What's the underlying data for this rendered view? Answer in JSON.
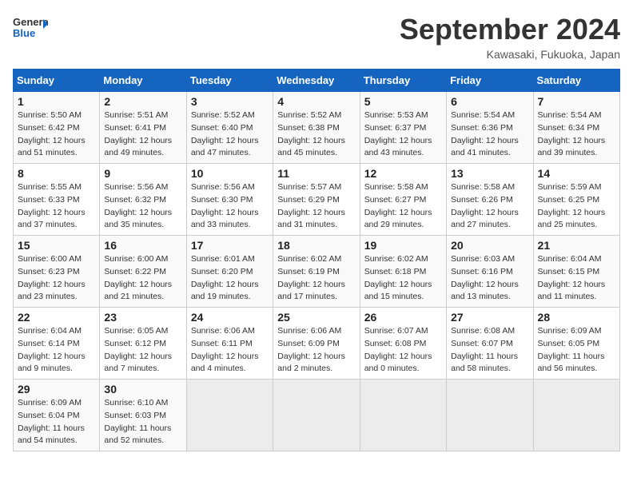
{
  "header": {
    "logo_general": "General",
    "logo_blue": "Blue",
    "month_title": "September 2024",
    "location": "Kawasaki, Fukuoka, Japan"
  },
  "weekdays": [
    "Sunday",
    "Monday",
    "Tuesday",
    "Wednesday",
    "Thursday",
    "Friday",
    "Saturday"
  ],
  "weeks": [
    [
      {
        "day": "1",
        "lines": [
          "Sunrise: 5:50 AM",
          "Sunset: 6:42 PM",
          "Daylight: 12 hours",
          "and 51 minutes."
        ]
      },
      {
        "day": "2",
        "lines": [
          "Sunrise: 5:51 AM",
          "Sunset: 6:41 PM",
          "Daylight: 12 hours",
          "and 49 minutes."
        ]
      },
      {
        "day": "3",
        "lines": [
          "Sunrise: 5:52 AM",
          "Sunset: 6:40 PM",
          "Daylight: 12 hours",
          "and 47 minutes."
        ]
      },
      {
        "day": "4",
        "lines": [
          "Sunrise: 5:52 AM",
          "Sunset: 6:38 PM",
          "Daylight: 12 hours",
          "and 45 minutes."
        ]
      },
      {
        "day": "5",
        "lines": [
          "Sunrise: 5:53 AM",
          "Sunset: 6:37 PM",
          "Daylight: 12 hours",
          "and 43 minutes."
        ]
      },
      {
        "day": "6",
        "lines": [
          "Sunrise: 5:54 AM",
          "Sunset: 6:36 PM",
          "Daylight: 12 hours",
          "and 41 minutes."
        ]
      },
      {
        "day": "7",
        "lines": [
          "Sunrise: 5:54 AM",
          "Sunset: 6:34 PM",
          "Daylight: 12 hours",
          "and 39 minutes."
        ]
      }
    ],
    [
      {
        "day": "8",
        "lines": [
          "Sunrise: 5:55 AM",
          "Sunset: 6:33 PM",
          "Daylight: 12 hours",
          "and 37 minutes."
        ]
      },
      {
        "day": "9",
        "lines": [
          "Sunrise: 5:56 AM",
          "Sunset: 6:32 PM",
          "Daylight: 12 hours",
          "and 35 minutes."
        ]
      },
      {
        "day": "10",
        "lines": [
          "Sunrise: 5:56 AM",
          "Sunset: 6:30 PM",
          "Daylight: 12 hours",
          "and 33 minutes."
        ]
      },
      {
        "day": "11",
        "lines": [
          "Sunrise: 5:57 AM",
          "Sunset: 6:29 PM",
          "Daylight: 12 hours",
          "and 31 minutes."
        ]
      },
      {
        "day": "12",
        "lines": [
          "Sunrise: 5:58 AM",
          "Sunset: 6:27 PM",
          "Daylight: 12 hours",
          "and 29 minutes."
        ]
      },
      {
        "day": "13",
        "lines": [
          "Sunrise: 5:58 AM",
          "Sunset: 6:26 PM",
          "Daylight: 12 hours",
          "and 27 minutes."
        ]
      },
      {
        "day": "14",
        "lines": [
          "Sunrise: 5:59 AM",
          "Sunset: 6:25 PM",
          "Daylight: 12 hours",
          "and 25 minutes."
        ]
      }
    ],
    [
      {
        "day": "15",
        "lines": [
          "Sunrise: 6:00 AM",
          "Sunset: 6:23 PM",
          "Daylight: 12 hours",
          "and 23 minutes."
        ]
      },
      {
        "day": "16",
        "lines": [
          "Sunrise: 6:00 AM",
          "Sunset: 6:22 PM",
          "Daylight: 12 hours",
          "and 21 minutes."
        ]
      },
      {
        "day": "17",
        "lines": [
          "Sunrise: 6:01 AM",
          "Sunset: 6:20 PM",
          "Daylight: 12 hours",
          "and 19 minutes."
        ]
      },
      {
        "day": "18",
        "lines": [
          "Sunrise: 6:02 AM",
          "Sunset: 6:19 PM",
          "Daylight: 12 hours",
          "and 17 minutes."
        ]
      },
      {
        "day": "19",
        "lines": [
          "Sunrise: 6:02 AM",
          "Sunset: 6:18 PM",
          "Daylight: 12 hours",
          "and 15 minutes."
        ]
      },
      {
        "day": "20",
        "lines": [
          "Sunrise: 6:03 AM",
          "Sunset: 6:16 PM",
          "Daylight: 12 hours",
          "and 13 minutes."
        ]
      },
      {
        "day": "21",
        "lines": [
          "Sunrise: 6:04 AM",
          "Sunset: 6:15 PM",
          "Daylight: 12 hours",
          "and 11 minutes."
        ]
      }
    ],
    [
      {
        "day": "22",
        "lines": [
          "Sunrise: 6:04 AM",
          "Sunset: 6:14 PM",
          "Daylight: 12 hours",
          "and 9 minutes."
        ]
      },
      {
        "day": "23",
        "lines": [
          "Sunrise: 6:05 AM",
          "Sunset: 6:12 PM",
          "Daylight: 12 hours",
          "and 7 minutes."
        ]
      },
      {
        "day": "24",
        "lines": [
          "Sunrise: 6:06 AM",
          "Sunset: 6:11 PM",
          "Daylight: 12 hours",
          "and 4 minutes."
        ]
      },
      {
        "day": "25",
        "lines": [
          "Sunrise: 6:06 AM",
          "Sunset: 6:09 PM",
          "Daylight: 12 hours",
          "and 2 minutes."
        ]
      },
      {
        "day": "26",
        "lines": [
          "Sunrise: 6:07 AM",
          "Sunset: 6:08 PM",
          "Daylight: 12 hours",
          "and 0 minutes."
        ]
      },
      {
        "day": "27",
        "lines": [
          "Sunrise: 6:08 AM",
          "Sunset: 6:07 PM",
          "Daylight: 11 hours",
          "and 58 minutes."
        ]
      },
      {
        "day": "28",
        "lines": [
          "Sunrise: 6:09 AM",
          "Sunset: 6:05 PM",
          "Daylight: 11 hours",
          "and 56 minutes."
        ]
      }
    ],
    [
      {
        "day": "29",
        "lines": [
          "Sunrise: 6:09 AM",
          "Sunset: 6:04 PM",
          "Daylight: 11 hours",
          "and 54 minutes."
        ]
      },
      {
        "day": "30",
        "lines": [
          "Sunrise: 6:10 AM",
          "Sunset: 6:03 PM",
          "Daylight: 11 hours",
          "and 52 minutes."
        ]
      },
      {
        "day": "",
        "lines": []
      },
      {
        "day": "",
        "lines": []
      },
      {
        "day": "",
        "lines": []
      },
      {
        "day": "",
        "lines": []
      },
      {
        "day": "",
        "lines": []
      }
    ]
  ]
}
